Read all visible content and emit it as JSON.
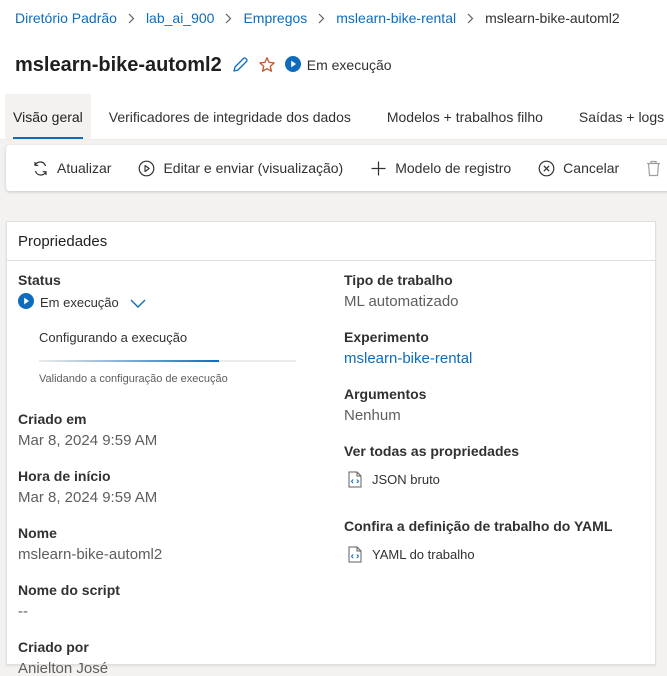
{
  "breadcrumb": {
    "items": [
      "Diretório Padrão",
      "lab_ai_900",
      "Empregos",
      "mslearn-bike-rental"
    ],
    "current": "mslearn-bike-automl2"
  },
  "header": {
    "title": "mslearn-bike-automl2",
    "status": "Em execução"
  },
  "tabs": [
    "Visão geral",
    "Verificadores de integridade dos dados",
    "Modelos + trabalhos filho",
    "Saídas + logs"
  ],
  "toolbar": {
    "refresh": "Atualizar",
    "edit_submit": "Editar e enviar (visualização)",
    "register_model": "Modelo de registro",
    "cancel": "Cancelar"
  },
  "properties": {
    "title": "Propriedades",
    "status_label": "Status",
    "status_value": "Em execução",
    "run_step": "Configurando a execução",
    "run_substep": "Validando a configuração de execução",
    "progress": 0.7,
    "created_on_label": "Criado em",
    "created_on": "Mar 8, 2024 9:59 AM",
    "start_time_label": "Hora de início",
    "start_time": "Mar 8, 2024 9:59 AM",
    "name_label": "Nome",
    "name": "mslearn-bike-automl2",
    "script_name_label": "Nome do script",
    "script_name": "--",
    "created_by_label": "Criado por",
    "created_by": "Anielton José",
    "job_type_label": "Tipo de trabalho",
    "job_type": "ML automatizado",
    "experiment_label": "Experimento",
    "experiment": "mslearn-bike-rental",
    "arguments_label": "Argumentos",
    "arguments": "Nenhum",
    "all_props_label": "Ver todas as propriedades",
    "raw_json": "JSON bruto",
    "yaml_label": "Confira a definição de trabalho do YAML",
    "job_yaml": "YAML do trabalho"
  },
  "colors": {
    "accent": "#0f6cbd",
    "star": "#c4532e",
    "text": "#323130",
    "muted": "#605e5c"
  }
}
